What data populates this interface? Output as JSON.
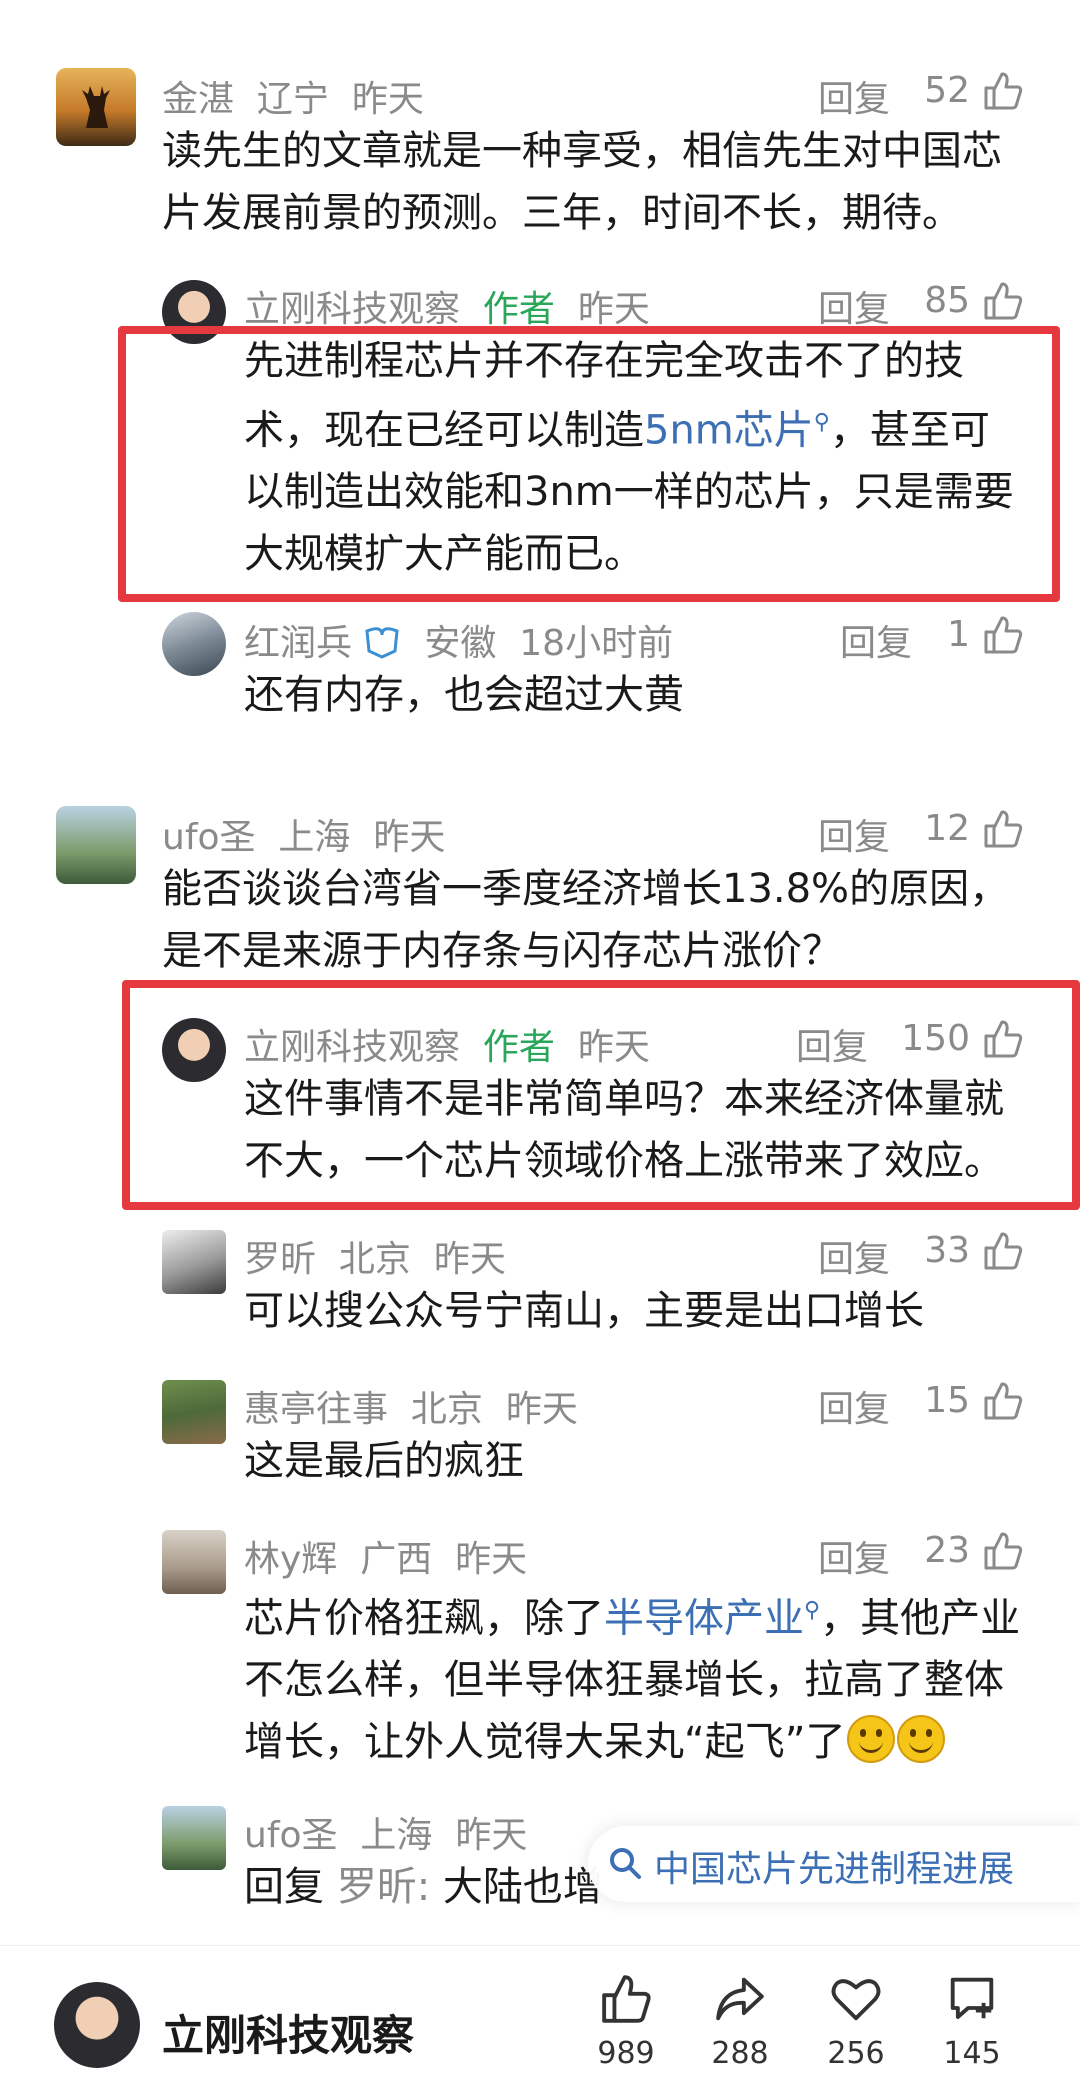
{
  "comments": [
    {
      "name": "金湛",
      "loc": "辽宁",
      "time": "昨天",
      "reply": "回复",
      "likes": "52",
      "text": "读先生的文章就是一种享受，相信先生对中国芯片发展前景的预测。三年，时间不长，期待。"
    },
    {
      "name": "立刚科技观察",
      "tag": "作者",
      "time": "昨天",
      "reply": "回复",
      "likes": "85",
      "text_a": "先进制程芯片并不存在完全攻击不了的技术，现在已经可以制造",
      "link": "5nm芯片",
      "text_b": "，甚至可以制造出效能和3nm一样的芯片，只是需要大规模扩大产能而已。"
    },
    {
      "name": "红润兵",
      "loc": "安徽",
      "time": "18小时前",
      "reply": "回复",
      "likes": "1",
      "text": "还有内存，也会超过大黄"
    },
    {
      "name": "ufo圣",
      "loc": "上海",
      "time": "昨天",
      "reply": "回复",
      "likes": "12",
      "text": "能否谈谈台湾省一季度经济增长13.8%的原因，是不是来源于内存条与闪存芯片涨价？"
    },
    {
      "name": "立刚科技观察",
      "tag": "作者",
      "time": "昨天",
      "reply": "回复",
      "likes": "150",
      "text": "这件事情不是非常简单吗？本来经济体量就不大，一个芯片领域价格上涨带来了效应。"
    },
    {
      "name": "罗昕",
      "loc": "北京",
      "time": "昨天",
      "reply": "回复",
      "likes": "33",
      "text": "可以搜公众号宁南山，主要是出口增长"
    },
    {
      "name": "惠亭往事",
      "loc": "北京",
      "time": "昨天",
      "reply": "回复",
      "likes": "15",
      "text": "这是最后的疯狂"
    },
    {
      "name": "林y辉",
      "loc": "广西",
      "time": "昨天",
      "reply": "回复",
      "likes": "23",
      "text_a": "芯片价格狂飙，除了",
      "link": "半导体产业",
      "text_b": "，其他产业不怎么样，但半导体狂暴增长，拉高了整体增长，让外人觉得大呆丸“起飞”了"
    },
    {
      "name": "ufo圣",
      "loc": "上海",
      "time": "昨天",
      "reply_prefix": "回复",
      "reply_to": "罗昕:",
      "text": "大陆也增"
    }
  ],
  "search_suggestion": "中国芯片先进制程进展",
  "bottom": {
    "author": "立刚科技观察",
    "like": "989",
    "share": "288",
    "fav": "256",
    "comment": "145"
  },
  "colors": {
    "author_tag": "#2aa65a",
    "link": "#3c6fb4",
    "highlight_box": "#e5393f"
  }
}
